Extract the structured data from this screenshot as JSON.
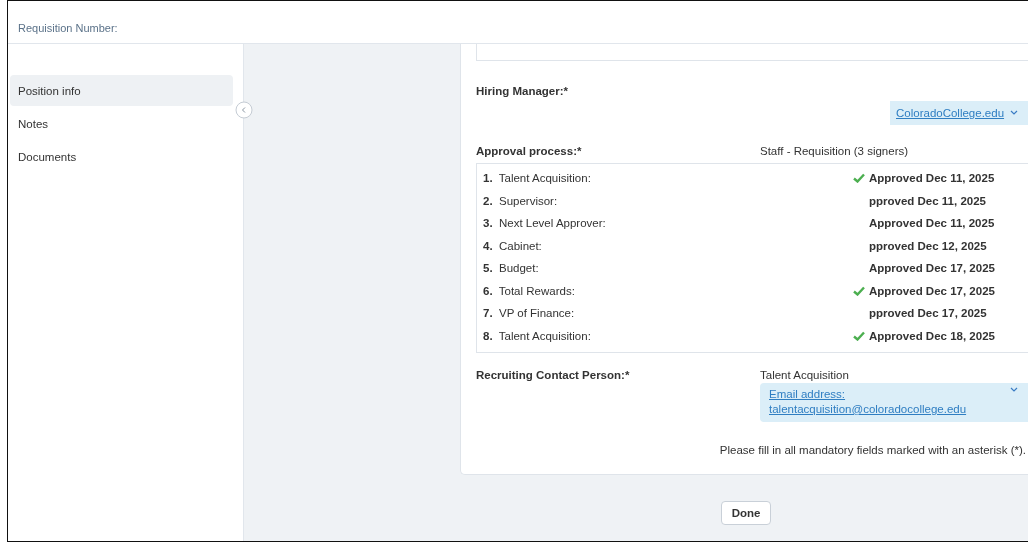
{
  "header": {
    "title": "Requisition Number:"
  },
  "sidebar": {
    "items": [
      {
        "label": "Position info",
        "selected": true
      },
      {
        "label": "Notes",
        "selected": false
      },
      {
        "label": "Documents",
        "selected": false
      }
    ]
  },
  "form": {
    "hiring_manager": {
      "label": "Hiring Manager:*",
      "value": "ColoradoCollege.edu"
    },
    "approval": {
      "label": "Approval process:*",
      "template": "Staff - Requisition (3 signers)",
      "steps": [
        {
          "number": "1.",
          "name": "Talent Acquisition:",
          "status": "Approved Dec 11, 2025",
          "checked": true
        },
        {
          "number": "2.",
          "name": "Supervisor:",
          "status": "pproved Dec 11, 2025",
          "checked": false
        },
        {
          "number": "3.",
          "name": "Next Level Approver:",
          "status": "Approved Dec 11, 2025",
          "checked": false
        },
        {
          "number": "4.",
          "name": "Cabinet:",
          "status": "pproved Dec 12, 2025",
          "checked": false
        },
        {
          "number": "5.",
          "name": "Budget:",
          "status": "Approved Dec 17, 2025",
          "checked": false
        },
        {
          "number": "6.",
          "name": "Total Rewards:",
          "status": "Approved Dec 17, 2025",
          "checked": true
        },
        {
          "number": "7.",
          "name": "VP of Finance:",
          "status": "pproved Dec 17, 2025",
          "checked": false
        },
        {
          "number": "8.",
          "name": "Talent Acquisition:",
          "status": "Approved Dec 18, 2025",
          "checked": true
        }
      ]
    },
    "recruiting_contact": {
      "label": "Recruiting Contact Person:*",
      "name": "Talent Acquisition",
      "value": "Email address: talentacquisition@coloradocollege.edu"
    },
    "note": "Please fill in all mandatory fields marked with an asterisk (*)."
  },
  "buttons": [
    "Done"
  ]
}
